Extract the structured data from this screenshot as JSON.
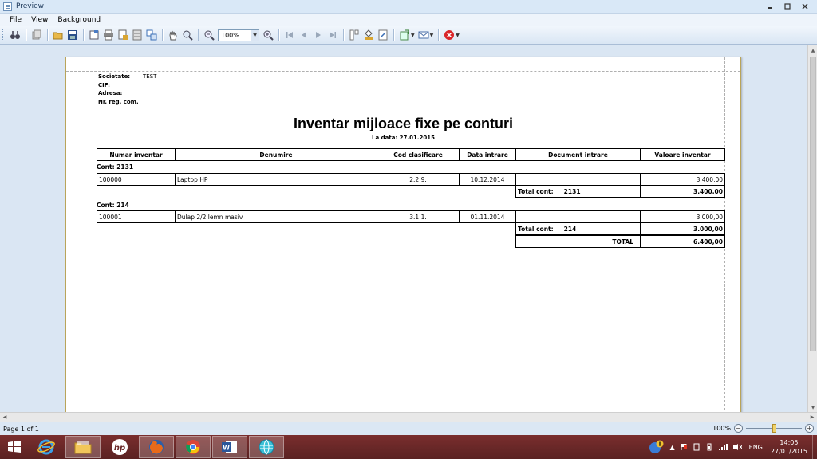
{
  "window": {
    "title": "Preview"
  },
  "menu": [
    "File",
    "View",
    "Background"
  ],
  "toolbar": {
    "zoom_value": "100%"
  },
  "report": {
    "company": [
      {
        "label": "Societate:",
        "value": "TEST"
      },
      {
        "label": "CIF:",
        "value": ""
      },
      {
        "label": "Adresa:",
        "value": ""
      },
      {
        "label": "Nr. reg. com.",
        "value": ""
      }
    ],
    "title": "Inventar mijloace fixe pe conturi",
    "date_line": "La data: 27.01.2015",
    "columns": [
      "Numar inventar",
      "Denumire",
      "Cod clasificare",
      "Data intrare",
      "Document intrare",
      "Valoare inventar"
    ],
    "groups": [
      {
        "label": "Cont:  2131",
        "row": [
          "100000",
          "Laptop HP",
          "2.2.9.",
          "10.12.2014",
          "",
          "3.400,00"
        ],
        "total_label": "Total cont:     2131",
        "total_value": "3.400,00"
      },
      {
        "label": "Cont:  214",
        "row": [
          "100001",
          "Dulap 2/2 lemn masiv",
          "3.1.1.",
          "01.11.2014",
          "",
          "3.000,00"
        ],
        "total_label": "Total cont:     214",
        "total_value": "3.000,00"
      }
    ],
    "grand_total_label": "TOTAL",
    "grand_total_value": "6.400,00"
  },
  "status": {
    "page": "Page 1 of 1",
    "zoom": "100%",
    "zoom_minus": "−",
    "zoom_plus": "+",
    "zoom_level_percent": 100
  },
  "taskbar": {
    "apps": [
      "file-explorer",
      "hp",
      "firefox",
      "chrome",
      "word",
      "active-app"
    ],
    "lang": "ENG",
    "time": "14:05",
    "date": "27/01/2015"
  },
  "colors": {
    "taskbar": "#6b2828",
    "workspace": "#dae6f3",
    "paper_border": "#b9a45a"
  }
}
